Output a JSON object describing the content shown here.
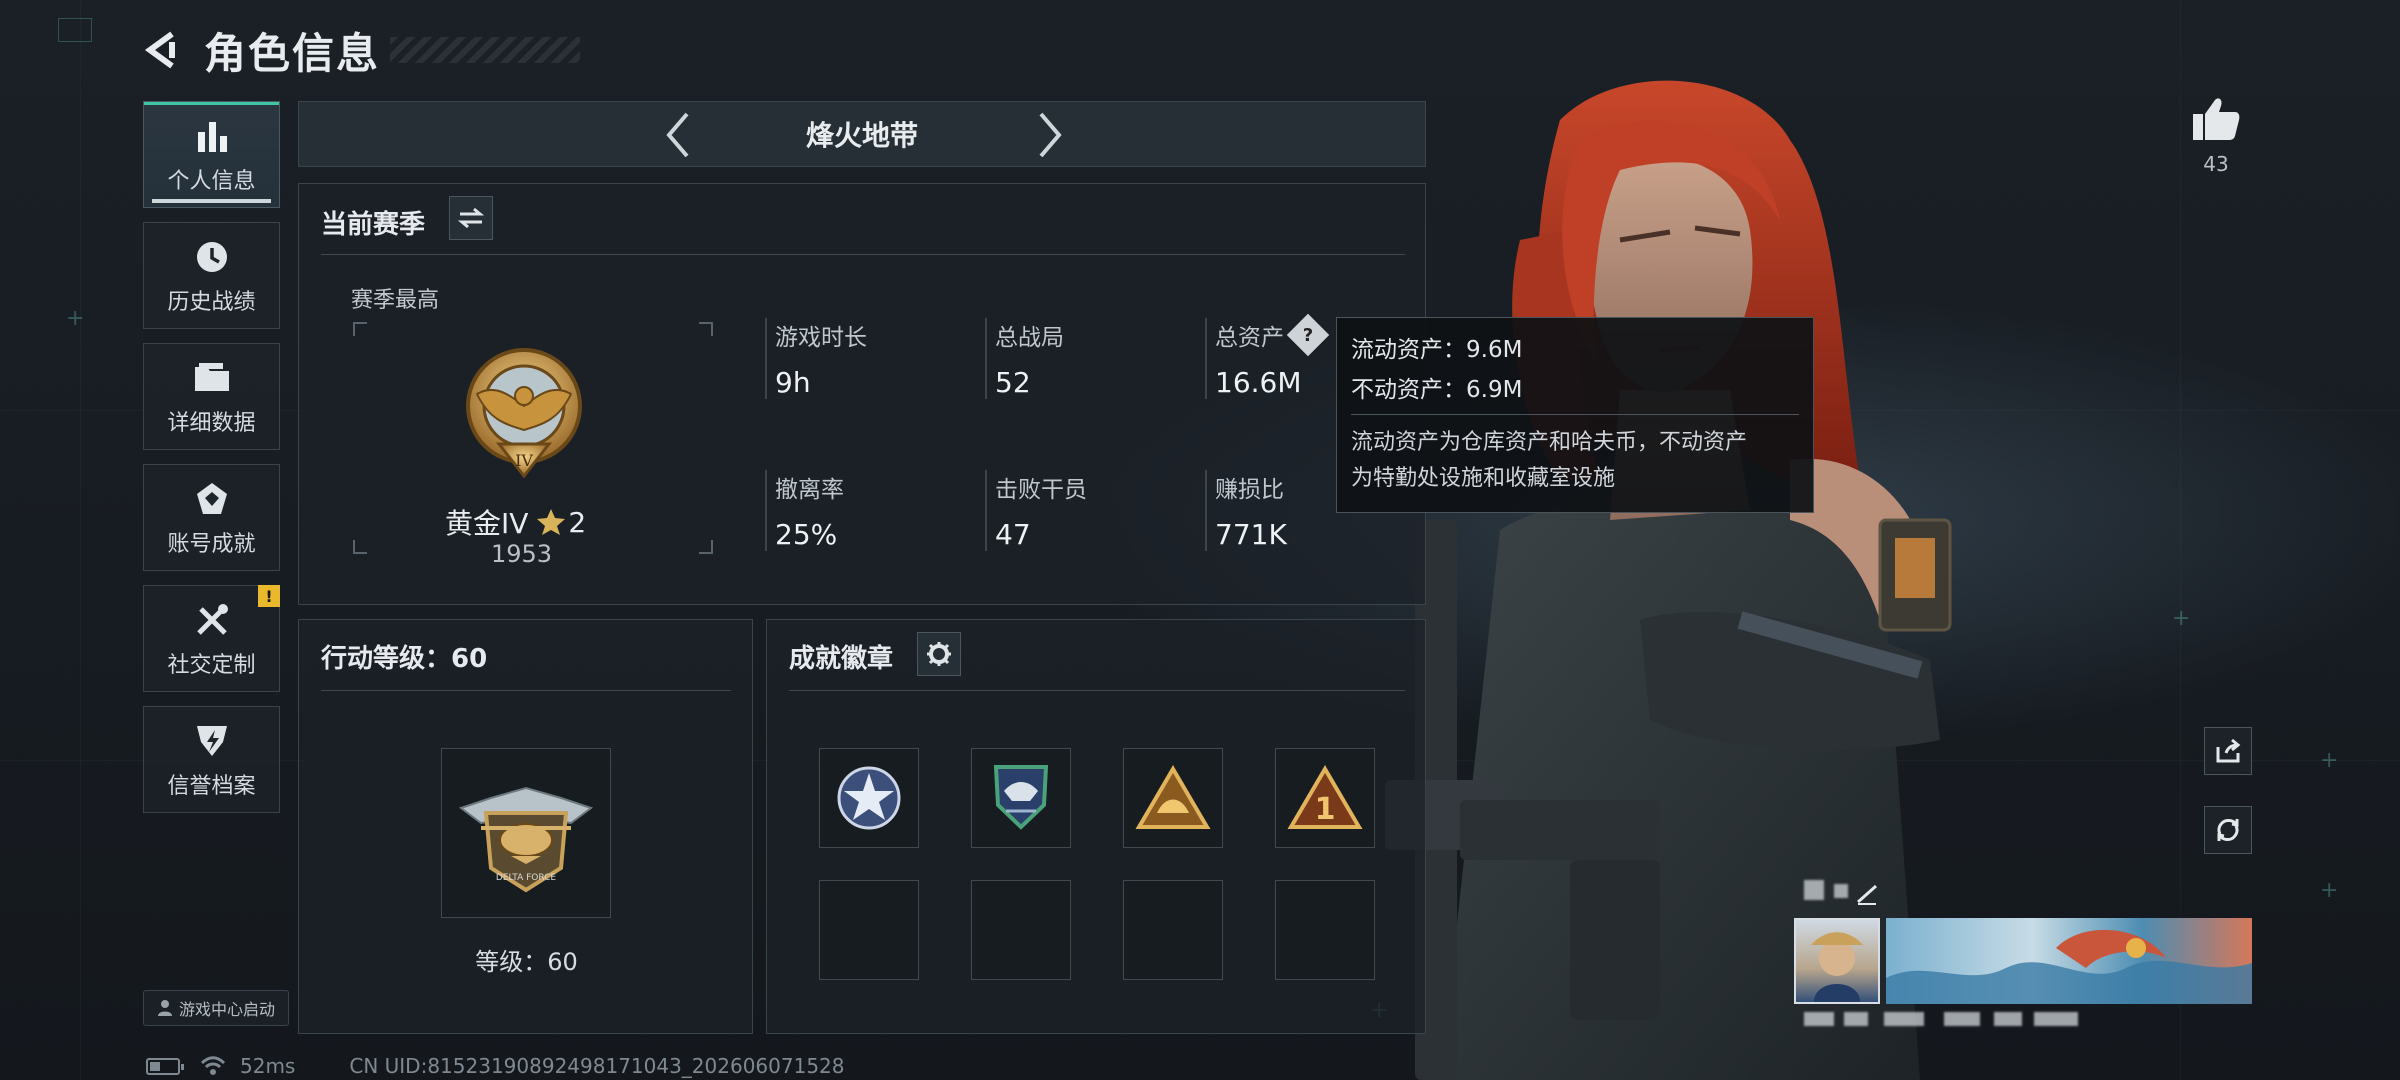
{
  "header": {
    "title": "角色信息"
  },
  "nav": {
    "items": [
      {
        "label": "个人信息",
        "icon": "bar-chart-icon",
        "active": true
      },
      {
        "label": "历史战绩",
        "icon": "history-clock-icon"
      },
      {
        "label": "详细数据",
        "icon": "folder-icon"
      },
      {
        "label": "账号成就",
        "icon": "achievement-icon"
      },
      {
        "label": "社交定制",
        "icon": "tools-icon",
        "alert": "!"
      },
      {
        "label": "信誉档案",
        "icon": "credit-shield-icon"
      }
    ],
    "game_center_label": "游戏中心启动"
  },
  "status_bar": {
    "ping": "52ms",
    "uid": "CN UID:81523190892498171043_202606071528"
  },
  "mode": {
    "title": "烽火地带"
  },
  "season": {
    "title": "当前赛季",
    "best_label": "赛季最高",
    "rank_name": "黄金IV",
    "rank_emblem_numeral": "IV",
    "stars": "2",
    "score": "1953",
    "stats": [
      {
        "label": "游戏时长",
        "value": "9h"
      },
      {
        "label": "总战局",
        "value": "52"
      },
      {
        "label": "总资产",
        "value": "16.6M"
      },
      {
        "label": "撤离率",
        "value": "25%"
      },
      {
        "label": "击败干员",
        "value": "47"
      },
      {
        "label": "赚损比",
        "value": "771K"
      }
    ]
  },
  "tooltip": {
    "liquid": "流动资产：9.6M",
    "fixed": "不动资产：6.9M",
    "desc_line1": "流动资产为仓库资产和哈夫币，不动资产",
    "desc_line2": "为特勤处设施和收藏室设施"
  },
  "action_level": {
    "title": "行动等级：60",
    "level_text": "等级：60",
    "emblem_text": "DELTA FORCE"
  },
  "badges": {
    "title": "成就徽章",
    "row1": [
      "star-emblem-icon",
      "eagle-crest-icon",
      "gold-triangle-hat-icon",
      "gold-triangle-one-icon"
    ],
    "row1_numeral": "1"
  },
  "likes": {
    "count": "43"
  },
  "colors": {
    "accent": "#3fc7a5",
    "warning": "#e9b82b",
    "hair": "#b83a22"
  }
}
